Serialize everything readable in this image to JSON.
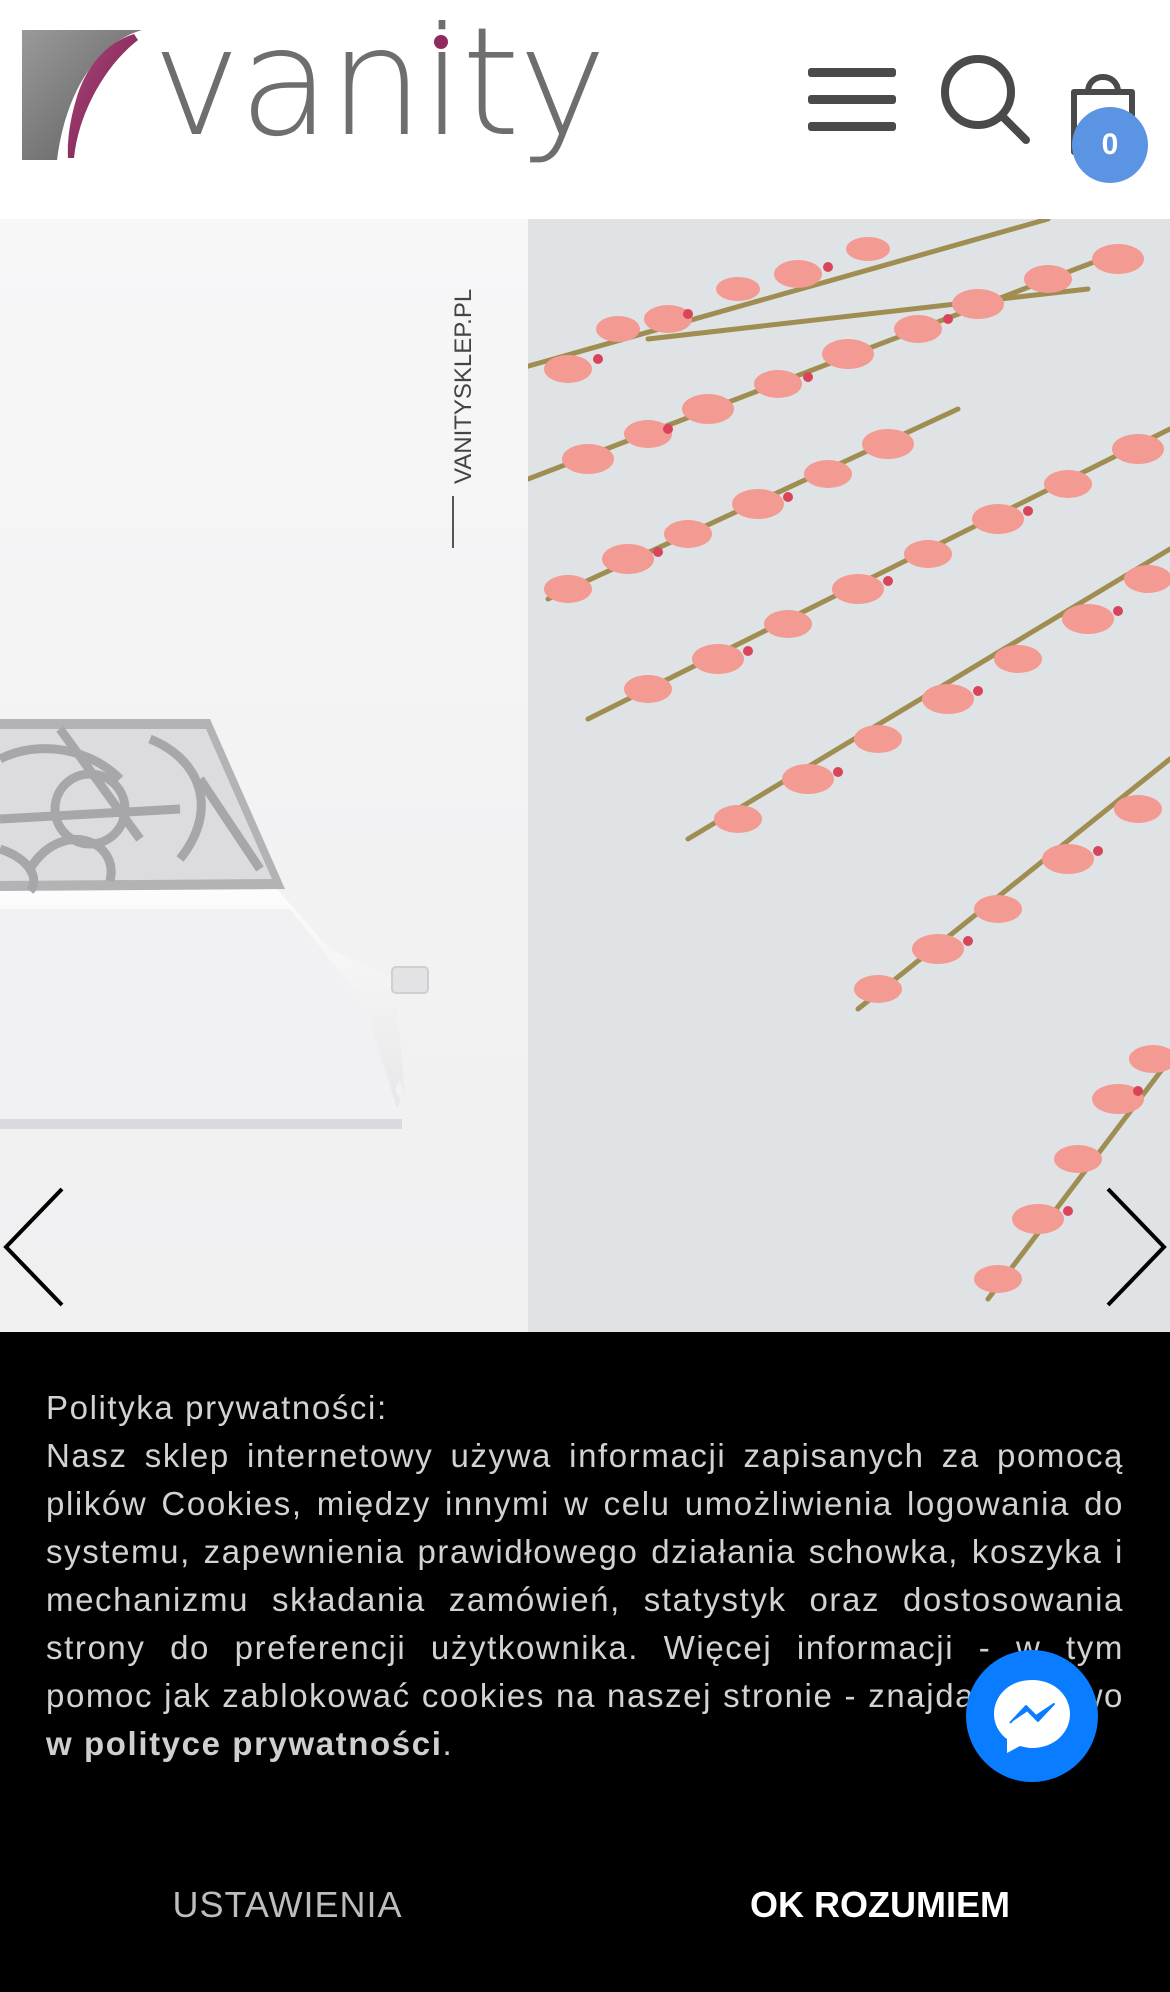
{
  "header": {
    "logo_text": "vanity",
    "cart_count": "0"
  },
  "slider": {
    "left_slide_brand": "VANITYSKLEP.PL"
  },
  "cookie": {
    "title": "Polityka prywatności:",
    "body": "Nasz sklep internetowy używa informacji zapisanych za pomocą plików Cookies, między innymi w celu umożliwienia logowania do systemu, zapewnienia prawidłowego działania schowka, koszyka i mechanizmu składania zamówień, statystyk oraz dostosowania strony do preferencji użytkownika. Więcej informacji - w tym pomoc jak zablokować cookies na naszej stronie - znajdą Państwo ",
    "link_text": "w polityce prywatności",
    "trailing": ".",
    "settings_label": "USTAWIENIA",
    "ok_label": "OK ROZUMIEM"
  },
  "colors": {
    "accent": "#5b94e2",
    "logo_gray": "#6e6e6e",
    "logo_plum": "#8f2a5f",
    "messenger": "#0a7cff",
    "banner_bg": "#000000"
  },
  "icons": [
    "hamburger-menu-icon",
    "search-icon",
    "shopping-bag-icon",
    "chevron-left-icon",
    "chevron-right-icon",
    "messenger-icon"
  ]
}
